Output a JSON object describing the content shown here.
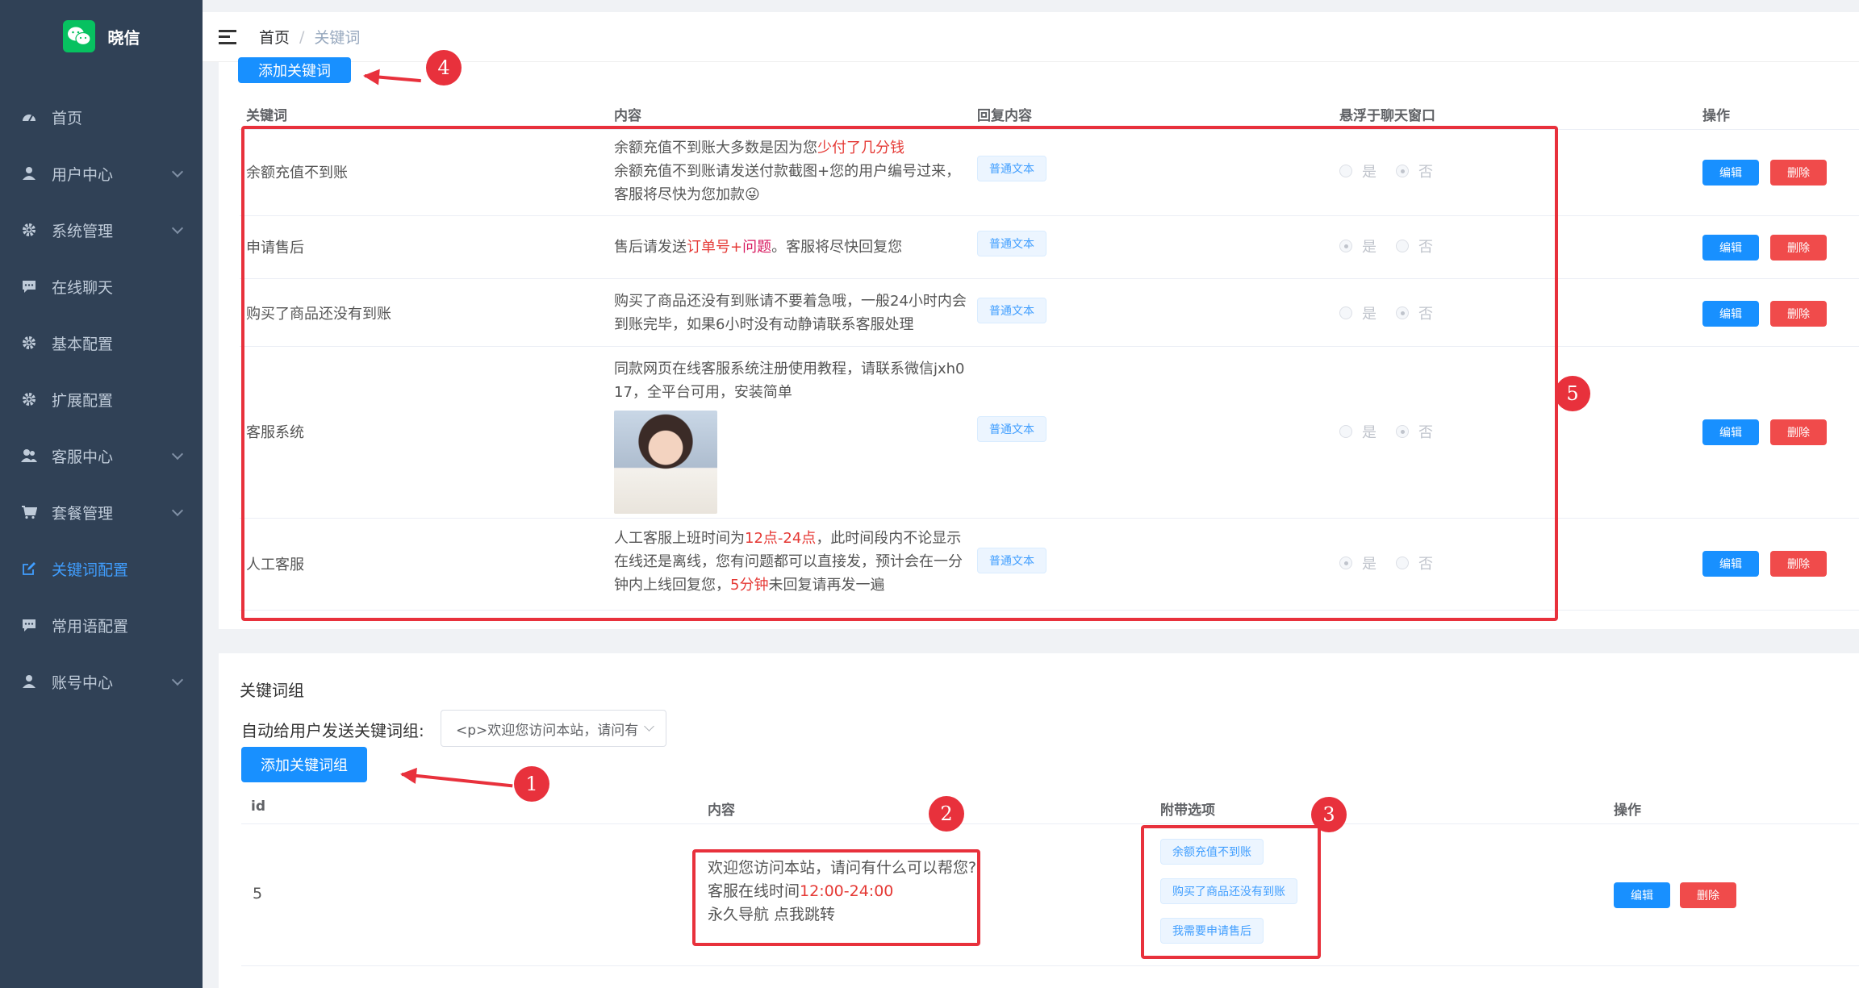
{
  "brand": {
    "name": "晓信"
  },
  "sidebar": {
    "items": [
      {
        "label": "首页",
        "icon": "dashboard-icon",
        "has_children": false,
        "active": false
      },
      {
        "label": "用户中心",
        "icon": "user-icon",
        "has_children": true,
        "active": false
      },
      {
        "label": "系统管理",
        "icon": "gear-icon",
        "has_children": true,
        "active": false
      },
      {
        "label": "在线聊天",
        "icon": "chat-icon",
        "has_children": false,
        "active": false
      },
      {
        "label": "基本配置",
        "icon": "gear-icon",
        "has_children": false,
        "active": false
      },
      {
        "label": "扩展配置",
        "icon": "gear-icon",
        "has_children": false,
        "active": false
      },
      {
        "label": "客服中心",
        "icon": "users-icon",
        "has_children": true,
        "active": false
      },
      {
        "label": "套餐管理",
        "icon": "cart-icon",
        "has_children": true,
        "active": false
      },
      {
        "label": "关键词配置",
        "icon": "edit-icon",
        "has_children": false,
        "active": true
      },
      {
        "label": "常用语配置",
        "icon": "chat-icon",
        "has_children": false,
        "active": false
      },
      {
        "label": "账号中心",
        "icon": "user-icon",
        "has_children": true,
        "active": false
      }
    ]
  },
  "breadcrumb": {
    "home": "首页",
    "sep": "/",
    "current": "关键词"
  },
  "keywords": {
    "add_label": "添加关键词",
    "columns": {
      "keyword": "关键词",
      "content": "内容",
      "reply": "回复内容",
      "float": "悬浮于聊天窗口",
      "ops": "操作"
    },
    "radio_yes": "是",
    "radio_no": "否",
    "edit_label": "编辑",
    "delete_label": "删除",
    "rows": [
      {
        "keyword": "余额充值不到账",
        "reply_tag": "普通文本",
        "content": {
          "l1a": "余额充值不到账大多数是因为您",
          "l1b": "少付了几分钱",
          "l2": "余额充值不到账请发送付款截图+您的用户编号过来，",
          "l3": "客服将尽快为您加款😜"
        },
        "float": "no"
      },
      {
        "keyword": "申请售后",
        "reply_tag": "普通文本",
        "content": {
          "a": "售后请发送",
          "b": "订单号",
          "c": "+",
          "d": "问题",
          "e": "。客服将尽快回复您"
        },
        "float": "yes"
      },
      {
        "keyword": "购买了商品还没有到账",
        "reply_tag": "普通文本",
        "content": {
          "l1": "购买了商品还没有到账请不要着急哦，一般24小时内会",
          "l2": "到账完毕，如果6小时没有动静请联系客服处理"
        },
        "float": "no"
      },
      {
        "keyword": "客服系统",
        "reply_tag": "普通文本",
        "content": {
          "l1": "同款网页在线客服系统注册使用教程，请联系微信jxh0",
          "l2": "17，全平台可用，安装简单"
        },
        "float": "no"
      },
      {
        "keyword": "人工客服",
        "reply_tag": "普通文本",
        "content": {
          "l1a": "人工客服上班时间为",
          "l1b": "12点-24点",
          "l1c": "，此时间段内不论显示",
          "l2": "在线还是离线，您有问题都可以直接发，预计会在一分",
          "l3a": "钟内上线回复您，",
          "l3b": "5分钟",
          "l3c": "未回复请再发一遍"
        },
        "float": "yes"
      }
    ]
  },
  "groups": {
    "title": "关键词组",
    "auto_label": "自动给用户发送关键词组:",
    "select_value": "<p>欢迎您访问本站，请问有",
    "add_label": "添加关键词组",
    "columns": {
      "id": "id",
      "content": "内容",
      "options": "附带选项",
      "ops": "操作"
    },
    "row": {
      "id": "5",
      "l1": "欢迎您访问本站，请问有什么可以帮您?",
      "l2a": "客服在线时间",
      "l2b": "12:00-24:00",
      "l3": "永久导航 点我跳转",
      "tags": [
        "余额充值不到账",
        "购买了商品还没有到账",
        "我需要申请售后"
      ]
    },
    "edit_label": "编辑",
    "delete_label": "删除"
  },
  "annotations": {
    "b1": "1",
    "b2": "2",
    "b3": "3",
    "b4": "4",
    "b5": "5"
  },
  "colors": {
    "accent": "#1890ff",
    "danger": "#f04b4b",
    "sidebar": "#304156",
    "annotation": "#e8313c"
  }
}
